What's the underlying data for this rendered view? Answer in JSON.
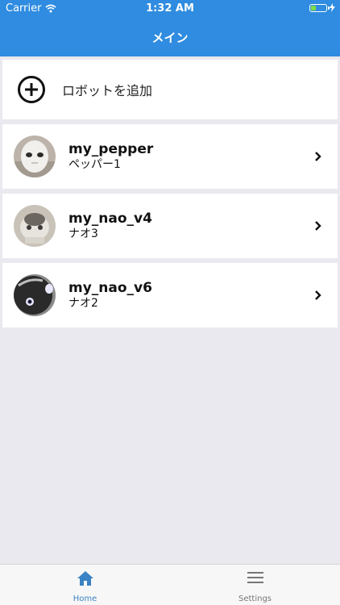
{
  "status": {
    "carrier": "Carrier",
    "time": "1:32 AM",
    "battery_level": 0.35
  },
  "nav": {
    "title": "メイン"
  },
  "add_robot": {
    "label": "ロボットを追加",
    "icon": "plus-circle-icon"
  },
  "robots": [
    {
      "name": "my_pepper",
      "subtitle": "ペッパー1"
    },
    {
      "name": "my_nao_v4",
      "subtitle": "ナオ3"
    },
    {
      "name": "my_nao_v6",
      "subtitle": "ナオ2"
    }
  ],
  "tabs": [
    {
      "label": "Home",
      "icon": "home-icon",
      "active": true
    },
    {
      "label": "Settings",
      "icon": "menu-icon",
      "active": false
    }
  ],
  "colors": {
    "accent": "#2f8ce0",
    "background": "#e9e9ef",
    "tab_active": "#3b82c4",
    "tab_inactive": "#777777"
  }
}
